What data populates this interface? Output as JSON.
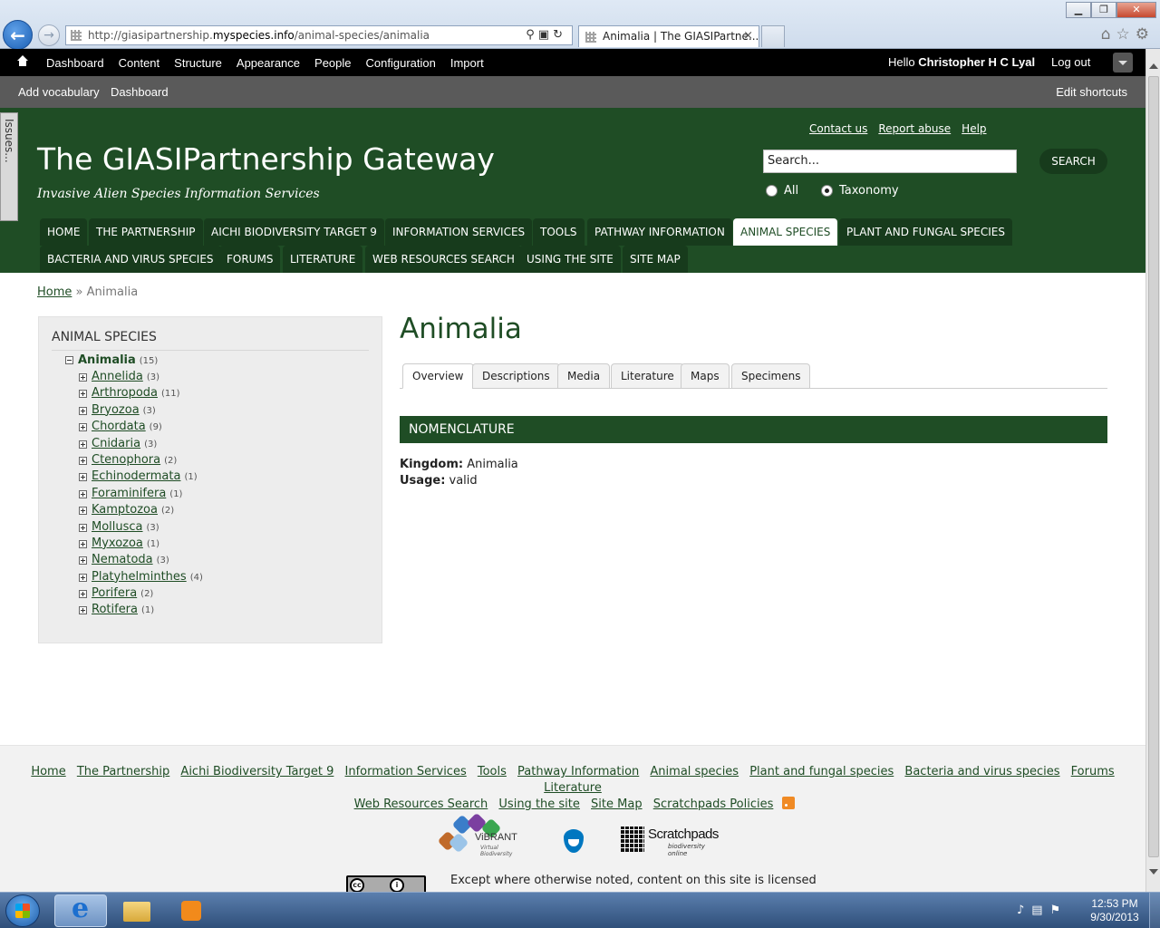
{
  "browser": {
    "url_prefix": "http://giasipartnership.",
    "url_domain": "myspecies.info",
    "url_path": "/animal-species/animalia",
    "tab_title": "Animalia | The GIASIPartne...",
    "tab_close": "×"
  },
  "admin_toolbar": {
    "menu": [
      "Dashboard",
      "Content",
      "Structure",
      "Appearance",
      "People",
      "Configuration",
      "Import"
    ],
    "hello": "Hello ",
    "user": "Christopher H C Lyal",
    "logout": "Log out"
  },
  "shortcuts": {
    "add_vocabulary": "Add vocabulary",
    "dashboard": "Dashboard",
    "edit": "Edit shortcuts"
  },
  "issues_tab": "Issues...",
  "header": {
    "top_links": [
      "Contact us",
      "Report abuse",
      "Help"
    ],
    "site_title": "The GIASIPartnership Gateway",
    "slogan": "Invasive Alien Species Information Services",
    "search_placeholder": "Search...",
    "search_button": "SEARCH",
    "radio_all": "All",
    "radio_taxonomy": "Taxonomy",
    "radio_selected": "Taxonomy"
  },
  "main_nav": [
    "HOME",
    "THE PARTNERSHIP",
    "AICHI BIODIVERSITY TARGET 9",
    "INFORMATION SERVICES",
    "TOOLS",
    "PATHWAY INFORMATION",
    "ANIMAL SPECIES",
    "PLANT AND FUNGAL SPECIES",
    "BACTERIA AND VIRUS SPECIES",
    "FORUMS",
    "LITERATURE",
    "WEB RESOURCES SEARCH",
    "USING THE SITE",
    "SITE MAP"
  ],
  "main_nav_active": "ANIMAL SPECIES",
  "breadcrumb": {
    "home": "Home",
    "sep": " » ",
    "current": "Animalia"
  },
  "sidebar": {
    "title": "ANIMAL SPECIES",
    "root": {
      "label": "Animalia",
      "count": "(15)"
    },
    "items": [
      {
        "label": "Annelida",
        "count": "(3)"
      },
      {
        "label": "Arthropoda",
        "count": "(11)"
      },
      {
        "label": "Bryozoa",
        "count": "(3)"
      },
      {
        "label": "Chordata",
        "count": "(9)"
      },
      {
        "label": "Cnidaria",
        "count": "(3)"
      },
      {
        "label": "Ctenophora",
        "count": "(2)"
      },
      {
        "label": "Echinodermata",
        "count": "(1)"
      },
      {
        "label": "Foraminifera",
        "count": "(1)"
      },
      {
        "label": "Kamptozoa",
        "count": "(2)"
      },
      {
        "label": "Mollusca",
        "count": "(3)"
      },
      {
        "label": "Myxozoa",
        "count": "(1)"
      },
      {
        "label": "Nematoda",
        "count": "(3)"
      },
      {
        "label": "Platyhelminthes",
        "count": "(4)"
      },
      {
        "label": "Porifera",
        "count": "(2)"
      },
      {
        "label": "Rotifera",
        "count": "(1)"
      }
    ]
  },
  "content": {
    "title": "Animalia",
    "tabs": [
      "Overview",
      "Descriptions",
      "Media",
      "Literature",
      "Maps",
      "Specimens"
    ],
    "active_tab": "Overview",
    "section": "NOMENCLATURE",
    "kingdom_label": "Kingdom:",
    "kingdom_value": " Animalia",
    "usage_label": "Usage:",
    "usage_value": " valid"
  },
  "footer": {
    "links_row1": [
      "Home",
      "The Partnership",
      "Aichi Biodiversity Target 9",
      "Information Services",
      "Tools",
      "Pathway Information",
      "Animal species",
      "Plant and fungal species",
      "Bacteria and virus species",
      "Forums",
      "Literature"
    ],
    "links_row2": [
      "Web Resources Search",
      "Using the site",
      "Site Map",
      "Scratchpads Policies"
    ],
    "vibrant": "ViBRANT",
    "vibrant_sub": "Virtual Biodiversity",
    "scratchpads": "Scratchpads",
    "scratchpads_sub": "biodiversity online",
    "license": "Except where otherwise noted, content on this site is licensed"
  },
  "taskbar": {
    "time": "12:53 PM",
    "date": "9/30/2013"
  }
}
